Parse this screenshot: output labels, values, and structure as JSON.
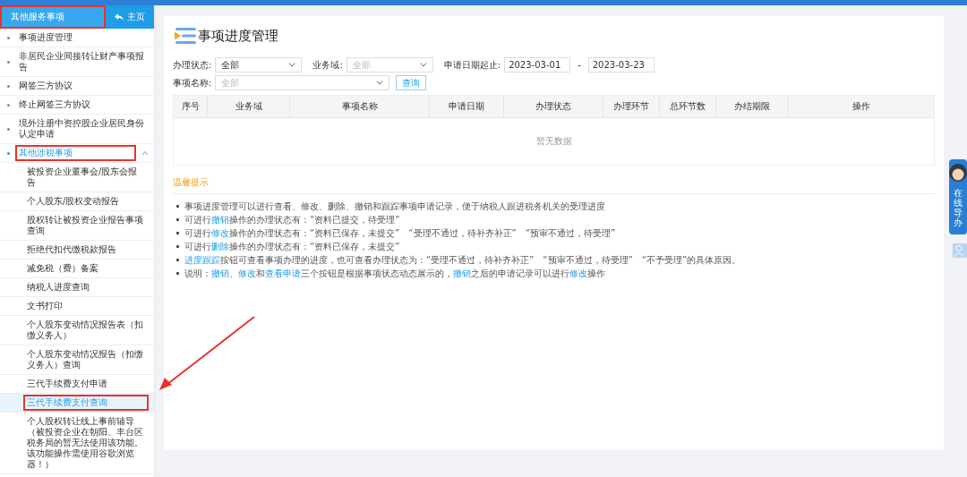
{
  "sidebar": {
    "header": {
      "label": "其他服务事项",
      "highlighted": true
    },
    "home_button": "主页",
    "items": [
      {
        "label": "事项进度管理",
        "selected": false,
        "highlighted": false
      },
      {
        "label": "非居民企业间接转让财产事项报告",
        "selected": false,
        "highlighted": false
      },
      {
        "label": "网签三方协议",
        "selected": false,
        "highlighted": false
      },
      {
        "label": "终止网签三方协议",
        "selected": false,
        "highlighted": false
      },
      {
        "label": "境外注册中资控股企业居民身份认定申请",
        "selected": false,
        "highlighted": false
      },
      {
        "label": "其他涉税事项",
        "selected": false,
        "highlighted": true,
        "expanded": true,
        "children": [
          {
            "label": "被投资企业董事会/股东会报告",
            "selected": false,
            "highlighted": false
          },
          {
            "label": "个人股东/股权变动报告",
            "selected": false,
            "highlighted": false
          },
          {
            "label": "股权转让被投资企业报告事项查询",
            "selected": false,
            "highlighted": false
          },
          {
            "label": "拒绝代扣代缴税款报告",
            "selected": false,
            "highlighted": false
          },
          {
            "label": "减免税（费）备案",
            "selected": false,
            "highlighted": false
          },
          {
            "label": "纳税人进度查询",
            "selected": false,
            "highlighted": false
          },
          {
            "label": "文书打印",
            "selected": false,
            "highlighted": false
          },
          {
            "label": "个人股东变动情况报告表（扣缴义务人）",
            "selected": false,
            "highlighted": false
          },
          {
            "label": "个人股东变动情况报告（扣缴义务人）查询",
            "selected": false,
            "highlighted": false
          },
          {
            "label": "三代手续费支付申请",
            "selected": false,
            "highlighted": false
          },
          {
            "label": "三代手续费支付查询",
            "selected": true,
            "highlighted": true
          },
          {
            "label": "个人股权转让线上事前辅导（被投资企业在朝阳、丰台区税务局的暂无法使用该功能。该功能操作需使用谷歌浏览器！）",
            "selected": false,
            "highlighted": false
          }
        ]
      }
    ]
  },
  "page": {
    "title": "事项进度管理",
    "filters": {
      "status": {
        "label": "办理状态:",
        "value": "全部"
      },
      "domain": {
        "label": "业务域:",
        "placeholder": "全部"
      },
      "dates": {
        "label": "申请日期起止:",
        "from": "2023-03-01",
        "separator": "-",
        "to": "2023-03-23"
      },
      "item_name": {
        "label": "事项名称:",
        "placeholder": "全部"
      },
      "query_button": "查询"
    },
    "table": {
      "columns": [
        "序号",
        "业务域",
        "事项名称",
        "申请日期",
        "办理状态",
        "办理环节",
        "总环节数",
        "办结期限",
        "操作"
      ],
      "empty_text": "暂无数据"
    },
    "tips": {
      "title": "温馨提示",
      "items": [
        [
          {
            "text": "事项进度管理可以进行查看、修改、删除、撤销和跟踪事项申请记录，便于纳税人跟进税务机关的受理进度",
            "kind": "text"
          }
        ],
        [
          {
            "text": "可进行",
            "kind": "text"
          },
          {
            "text": "撤销",
            "kind": "link"
          },
          {
            "text": "操作的办理状态有：“资料已提交，待受理”",
            "kind": "text"
          }
        ],
        [
          {
            "text": "可进行",
            "kind": "text"
          },
          {
            "text": "修改",
            "kind": "link"
          },
          {
            "text": "操作的办理状态有：“资料已保存，未提交”　“受理不通过，待补齐补正”　“预审不通过，待受理”",
            "kind": "text"
          }
        ],
        [
          {
            "text": "可进行",
            "kind": "text"
          },
          {
            "text": "删除",
            "kind": "link"
          },
          {
            "text": "操作的办理状态有：“资料已保存，未提交”",
            "kind": "text"
          }
        ],
        [
          {
            "text": "进度跟踪",
            "kind": "link"
          },
          {
            "text": "按钮可查看事项办理的进度，也可查看办理状态为：“受理不通过，待补齐补正”　“预审不通过，待受理”　“不予受理”的具体原因。",
            "kind": "text"
          }
        ],
        [
          {
            "text": "说明：",
            "kind": "text"
          },
          {
            "text": "撤销",
            "kind": "link"
          },
          {
            "text": "、",
            "kind": "text"
          },
          {
            "text": "修改",
            "kind": "link"
          },
          {
            "text": "和",
            "kind": "text"
          },
          {
            "text": "查看申请",
            "kind": "link"
          },
          {
            "text": "三个按钮是根据事项状态动态展示的，",
            "kind": "text"
          },
          {
            "text": "撤销",
            "kind": "link"
          },
          {
            "text": "之后的申请记录可以进行",
            "kind": "text"
          },
          {
            "text": "修改",
            "kind": "link"
          },
          {
            "text": "操作",
            "kind": "text"
          }
        ]
      ]
    }
  },
  "side_widget": {
    "label": "在线导办"
  },
  "annotation": {
    "arrow": true
  }
}
